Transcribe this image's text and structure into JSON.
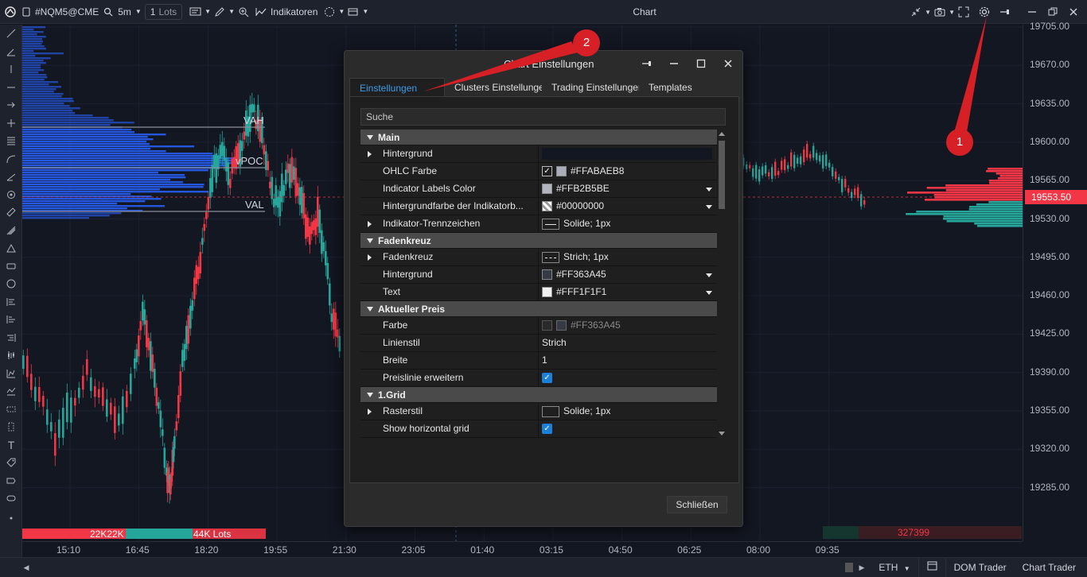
{
  "toolbar": {
    "symbol": "#NQM5@CME",
    "timeframe": "5m",
    "lots_value": "1",
    "lots_label": "Lots",
    "indicators_label": "Indikatoren",
    "window_title": "Chart"
  },
  "price_axis": {
    "ticks": [
      "19705.00",
      "19670.00",
      "19635.00",
      "19600.00",
      "19565.00",
      "19530.00",
      "19495.00",
      "19460.00",
      "19425.00",
      "19390.00",
      "19355.00",
      "19320.00",
      "19285.00"
    ],
    "current_price": "19553.50"
  },
  "time_axis": {
    "ticks": [
      "15:10",
      "16:45",
      "18:20",
      "19:55",
      "21:30",
      "23:05",
      "01:40",
      "03:15",
      "04:50",
      "06:25",
      "08:00",
      "09:35"
    ]
  },
  "chart_labels": {
    "vah": "VAH",
    "vpoc": "vPOC",
    "val": "VAL",
    "volume_left_a": "22K22K",
    "volume_left_b": "44K Lots",
    "volume_right": "327399"
  },
  "bottombar": {
    "session": "ETH",
    "dom_trader": "DOM Trader",
    "chart_trader": "Chart Trader"
  },
  "dialog": {
    "title": "Chart Einstellungen",
    "tabs": [
      "Einstellungen",
      "Clusters Einstellungen",
      "Trading Einstellungen",
      "Templates"
    ],
    "search_placeholder": "Suche",
    "close_button": "Schließen",
    "sections": [
      {
        "name": "Main",
        "rows": [
          {
            "label": "Hintergrund",
            "value": "",
            "expandable": true
          },
          {
            "label": "OHLC Farbe",
            "value": "#FFABAEB8"
          },
          {
            "label": "Indicator Labels Color",
            "value": "#FFB2B5BE"
          },
          {
            "label": "Hintergrundfarbe der Indikatorb...",
            "value": "#00000000"
          },
          {
            "label": "Indikator-Trennzeichen",
            "value": "Solide; 1px",
            "expandable": true
          }
        ]
      },
      {
        "name": "Fadenkreuz",
        "rows": [
          {
            "label": "Fadenkreuz",
            "value": "Strich; 1px",
            "expandable": true
          },
          {
            "label": "Hintergrund",
            "value": "#FF363A45"
          },
          {
            "label": "Text",
            "value": "#FFF1F1F1"
          }
        ]
      },
      {
        "name": "Aktueller Preis",
        "rows": [
          {
            "label": "Farbe",
            "value": "#FF363A45"
          },
          {
            "label": "Linienstil",
            "value": "Strich"
          },
          {
            "label": "Breite",
            "value": "1"
          },
          {
            "label": "Preislinie erweitern",
            "value": ""
          }
        ]
      },
      {
        "name": "1.Grid",
        "rows": [
          {
            "label": "Rasterstil",
            "value": "Solide; 1px",
            "expandable": true
          },
          {
            "label": "Show horizontal grid",
            "value": ""
          }
        ]
      }
    ]
  },
  "annotations": {
    "badge_1": "1",
    "badge_2": "2"
  },
  "colors": {
    "up": "#26a69a",
    "down": "#f23645",
    "profile": "#2962ff",
    "accent": "#3d9be9",
    "badge": "#d71f26"
  }
}
